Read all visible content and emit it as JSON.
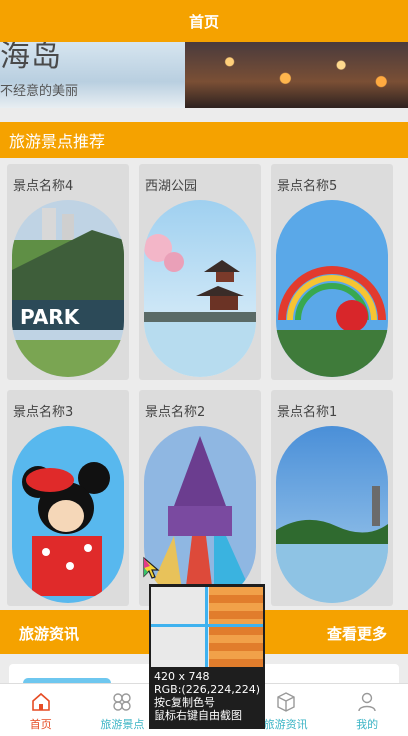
{
  "header": {
    "title": "首页"
  },
  "banner": {
    "title": "海岛",
    "subtitle": "不经意的美丽"
  },
  "section": {
    "title": "旅游景点推荐"
  },
  "attractions": [
    {
      "name": "景点名称4"
    },
    {
      "name": "西湖公园"
    },
    {
      "name": "景点名称5"
    },
    {
      "name": "景点名称3"
    },
    {
      "name": "景点名称2"
    },
    {
      "name": "景点名称1"
    }
  ],
  "news_section": {
    "title": "旅游资讯",
    "more": "查看更多"
  },
  "tabbar": [
    {
      "label": "首页",
      "icon": "home-icon",
      "active": true
    },
    {
      "label": "旅游景点",
      "icon": "grid-flower-icon",
      "active": false
    },
    {
      "label": "",
      "icon": "",
      "active": false
    },
    {
      "label": "旅游资讯",
      "icon": "cube-icon",
      "active": false
    },
    {
      "label": "我的",
      "icon": "user-icon",
      "active": false
    }
  ],
  "color_picker": {
    "size": "420 x 748",
    "rgb": "RGB:(226,224,224)",
    "hint1": "按c复制色号",
    "hint2": "鼠标右键自由截图"
  },
  "colors": {
    "accent": "#f5a200",
    "active_tab": "#e64c24",
    "tab_text": "#3bb4c5"
  }
}
